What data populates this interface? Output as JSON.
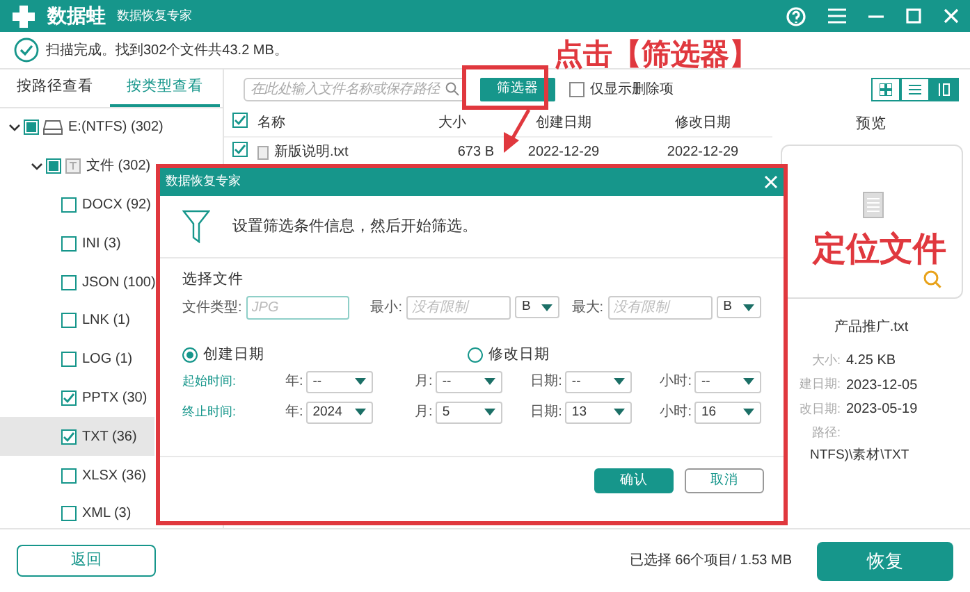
{
  "app": {
    "logo": "数据蛙",
    "subtitle": "数据恢复专家"
  },
  "scan_status": "扫描完成。找到302个文件共43.2 MB。",
  "view_tabs": [
    {
      "label": "按路径查看",
      "selected": false
    },
    {
      "label": "按类型查看",
      "selected": true
    }
  ],
  "search": {
    "placeholder": "在此处输入文件名称或保存路径"
  },
  "filter_button": "筛选器",
  "deleted_only": {
    "label": "仅显示删除项",
    "checked": false
  },
  "view_modes": [
    {
      "kind": "grid",
      "selected": false
    },
    {
      "kind": "list",
      "selected": false
    },
    {
      "kind": "detail",
      "selected": true
    }
  ],
  "tree": [
    {
      "kind": "drive",
      "label": "E:(NTFS) (302)",
      "checked": true,
      "partial": true,
      "expanded": true,
      "selected": false,
      "children": [
        {
          "kind": "folder",
          "label": "文件 (302)",
          "checked": true,
          "partial": true,
          "expanded": true,
          "selected": false,
          "children": [
            {
              "kind": "type",
              "label": "DOCX (92)",
              "checked": false,
              "selected": false
            },
            {
              "kind": "type",
              "label": "INI (3)",
              "checked": false,
              "selected": false
            },
            {
              "kind": "type",
              "label": "JSON (100)",
              "checked": false,
              "selected": false
            },
            {
              "kind": "type",
              "label": "LNK (1)",
              "checked": false,
              "selected": false
            },
            {
              "kind": "type",
              "label": "LOG (1)",
              "checked": false,
              "selected": false
            },
            {
              "kind": "type",
              "label": "PPTX (30)",
              "checked": true,
              "selected": false
            },
            {
              "kind": "type",
              "label": "TXT (36)",
              "checked": true,
              "selected": true
            },
            {
              "kind": "type",
              "label": "XLSX (36)",
              "checked": false,
              "selected": false
            },
            {
              "kind": "type",
              "label": "XML (3)",
              "checked": false,
              "selected": false
            }
          ]
        }
      ]
    }
  ],
  "file_table": {
    "header_checked": true,
    "columns": [
      "名称",
      "大小",
      "创建日期",
      "修改日期"
    ],
    "rows": [
      {
        "name": "新版说明.txt",
        "size": "673  B",
        "created": "2022-12-29",
        "modified": "2022-12-29",
        "checked": true
      }
    ]
  },
  "preview": {
    "title": "预览",
    "file_name": "产品推广.txt",
    "details": [
      {
        "label": "大小:",
        "value": "4.25 KB"
      },
      {
        "label": "建日期:",
        "value": "2023-12-05"
      },
      {
        "label": "改日期:",
        "value": "2023-05-19"
      },
      {
        "label": "路径:"
      }
    ],
    "path": "NTFS)\\素材\\TXT"
  },
  "back_button": "返回",
  "selection_summary": "已选择 66个项目/ 1.53 MB",
  "recover_button": "恢复",
  "filter_dialog": {
    "title": "数据恢复专家",
    "message": "设置筛选条件信息，然后开始筛选。",
    "section": "选择文件",
    "type_label": "文件类型:",
    "type_placeholder": "JPG",
    "min_label": "最小:",
    "min_placeholder": "没有限制",
    "min_unit": "B",
    "max_label": "最大:",
    "max_placeholder": "没有限制",
    "max_unit": "B",
    "date_modes": [
      {
        "label": "创建日期",
        "selected": true
      },
      {
        "label": "修改日期",
        "selected": false
      }
    ],
    "time_rows": [
      {
        "label": "起始时间:",
        "fields": [
          {
            "label": "年:",
            "value": "--"
          },
          {
            "label": "月:",
            "value": "--"
          },
          {
            "label": "日期:",
            "value": "--"
          },
          {
            "label": "小时:",
            "value": "--"
          }
        ]
      },
      {
        "label": "终止时间:",
        "fields": [
          {
            "label": "年:",
            "value": "2024"
          },
          {
            "label": "月:",
            "value": "5"
          },
          {
            "label": "日期:",
            "value": "13"
          },
          {
            "label": "小时:",
            "value": "16"
          }
        ]
      }
    ],
    "buttons": [
      {
        "kind": "primary",
        "label": "确认"
      },
      {
        "kind": "secondary",
        "label": "取消"
      }
    ]
  },
  "annotations": [
    {
      "kind": "callout",
      "text": "点击【筛选器】"
    },
    {
      "kind": "label",
      "text": "定位文件"
    }
  ]
}
